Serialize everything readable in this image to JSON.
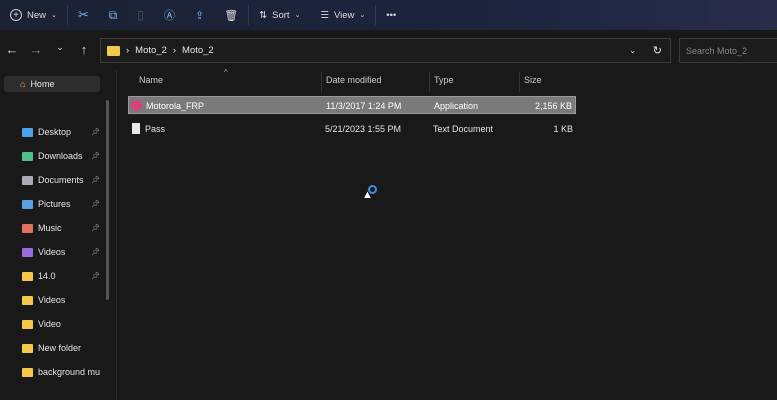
{
  "toolbar": {
    "new": "New",
    "sort": "Sort",
    "view": "View",
    "more": "•••"
  },
  "address": {
    "crumbs": [
      "Moto_2",
      "Moto_2"
    ],
    "search_placeholder": "Search Moto_2"
  },
  "sidebar": {
    "home": "Home",
    "items": [
      {
        "label": "Desktop",
        "pinned": true,
        "icon": "desktop-icon"
      },
      {
        "label": "Downloads",
        "pinned": true,
        "icon": "download-icon"
      },
      {
        "label": "Documents",
        "pinned": true,
        "icon": "documents-icon"
      },
      {
        "label": "Pictures",
        "pinned": true,
        "icon": "pictures-icon"
      },
      {
        "label": "Music",
        "pinned": true,
        "icon": "music-icon"
      },
      {
        "label": "Videos",
        "pinned": true,
        "icon": "videos-icon"
      },
      {
        "label": "14.0",
        "pinned": true,
        "icon": "folder-icon"
      },
      {
        "label": "Videos",
        "pinned": false,
        "icon": "folder-icon"
      },
      {
        "label": "Video",
        "pinned": false,
        "icon": "folder-icon"
      },
      {
        "label": "New folder",
        "pinned": false,
        "icon": "folder-icon"
      },
      {
        "label": "background mu",
        "pinned": false,
        "icon": "folder-icon"
      }
    ]
  },
  "columns": {
    "name": "Name",
    "date": "Date modified",
    "type": "Type",
    "size": "Size"
  },
  "files": [
    {
      "name": "Motorola_FRP",
      "date": "11/3/2017 1:24 PM",
      "type": "Application",
      "size": "2,156 KB",
      "selected": true
    },
    {
      "name": "Pass",
      "date": "5/21/2023 1:55 PM",
      "type": "Text Document",
      "size": "1 KB",
      "selected": false
    }
  ]
}
